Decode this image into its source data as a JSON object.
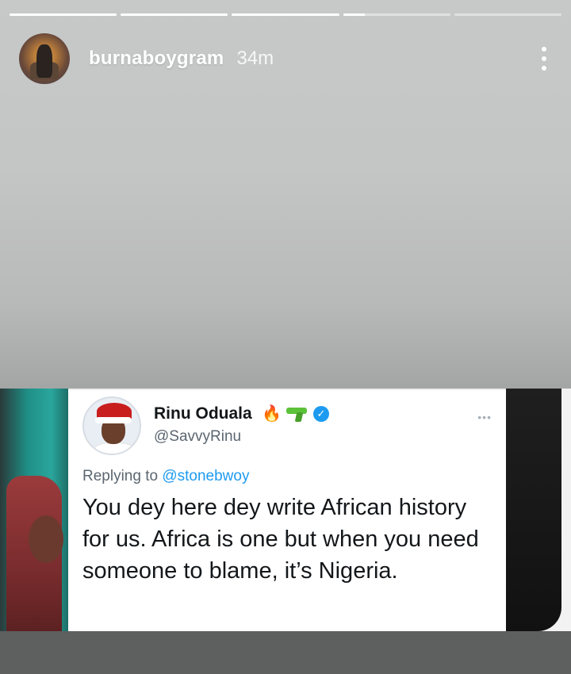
{
  "story": {
    "progress": [
      1,
      1,
      1,
      0.2,
      0
    ],
    "username": "burnaboygram",
    "timestamp": "34m",
    "menu_icon": "more-vertical-icon"
  },
  "tweet": {
    "name": "Rinu Oduala",
    "handle": "@SavvyRinu",
    "name_icons": [
      "fire-icon",
      "water-gun-icon",
      "verified-badge-icon"
    ],
    "replying_prefix": "Replying to",
    "replying_to": "@stonebwoy",
    "text": "You dey here dey write African history for us. Africa is one but when you need someone to blame, it’s Nigeria."
  },
  "colors": {
    "accent": "#1d9bf0",
    "story_text": "#ffffff"
  }
}
